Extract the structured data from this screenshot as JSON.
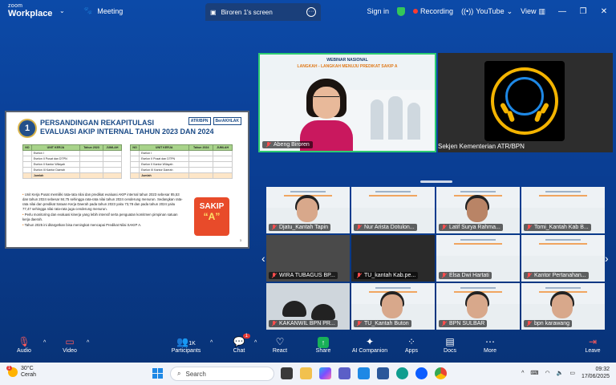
{
  "titlebar": {
    "brand_top": "zoom",
    "brand_bottom": "Workplace",
    "meeting_label": "Meeting",
    "tab_label": "Biroren 1's screen",
    "signin": "Sign in",
    "recording": "Recording",
    "youtube": "YouTube",
    "view": "View"
  },
  "slide": {
    "number": "1",
    "title_line1": "PERSANDINGAN REKAPITULASI",
    "title_line2": "EVALUASI AKIP INTERNAL TAHUN 2023 DAN 2024",
    "logo1": "ATR/BPN",
    "logo2": "BerAKHLAK",
    "table1_header": [
      "NO",
      "UNIT KERJA",
      "Tahun 2023",
      "JUMLAH"
    ],
    "table2_header": [
      "NO",
      "UNIT KERJA",
      "Tahun 2024",
      "JUMLAH"
    ],
    "rows": [
      "Eselon I",
      "Eselon II Pusat dan DTPN",
      "Eselon II Kantor Wilayah",
      "Eselon III Kantor Daerah"
    ],
    "total_label": "Jumlah",
    "bullets": [
      "Unit Kerja Pusat memiliki rata-rata nilai dan predikat evaluasi AKIP internal tahun 2023 sebesar 85,53 dan tahun 2024 sebesar 84,75 sehingga rata-rata nilai tahun 2024 cenderung menurun. Sedangkan rata-rata nilai dan predikat Satuan Kerja Daerah pada tahun 2023 yaitu 73,78 dan pada tahun 2024 yaitu 77,47 sehingga nilai rata-rata juga cenderung menurun.",
      "Perlu monitoring dan evaluasi kinerja yang lebih intensif serta penguatan komitmen pimpinan satuan kerja daerah.",
      "Tahun 2025 ini ditargetkan bisa meningkat mencapai Predikat Nilai SAKIP A."
    ],
    "sakip_label": "SAKIP",
    "sakip_grade": "“A”",
    "page": "3"
  },
  "speaker": {
    "banner_title": "WEBINAR NASIONAL",
    "banner_sub": "LANGKAH - LANGKAH MENUJU PREDIKAT SAKIP A",
    "name": "Abeng Biroren"
  },
  "logo_panel": {
    "name": "Sekjen Kementerian ATR/BPN"
  },
  "participants": [
    "Djatu_Kantah Tapin",
    "Nur Arista Dotulon...",
    "Latif Surya Rahma...",
    "Tomi_Kantah Kab B...",
    "WIRA TUBAGUS BP...",
    "TU_kantah Kab.pe...",
    "Elsa Dwi Hartati",
    "Kantor Pertanahan...",
    "KAKANWIL BPN PR...",
    "TU_Kantah Buton",
    "BPN SULBAR",
    "bpn karawang"
  ],
  "controls": {
    "audio": "Audio",
    "video": "Video",
    "participants": "Participants",
    "participants_count": "1K",
    "chat": "Chat",
    "chat_badge": "1",
    "react": "React",
    "share": "Share",
    "ai": "AI Companion",
    "apps": "Apps",
    "docs": "Docs",
    "more": "More",
    "leave": "Leave"
  },
  "taskbar": {
    "temp": "30°C",
    "weather": "Cerah",
    "weather_badge": "1",
    "search": "Search",
    "time": "09:32",
    "date": "17/06/2025"
  },
  "colors": {
    "meeting_bg": "#0c4aa8",
    "active_speaker_border": "#2ecc71",
    "share_green": "#18b058",
    "record_red": "#ff3b30"
  }
}
